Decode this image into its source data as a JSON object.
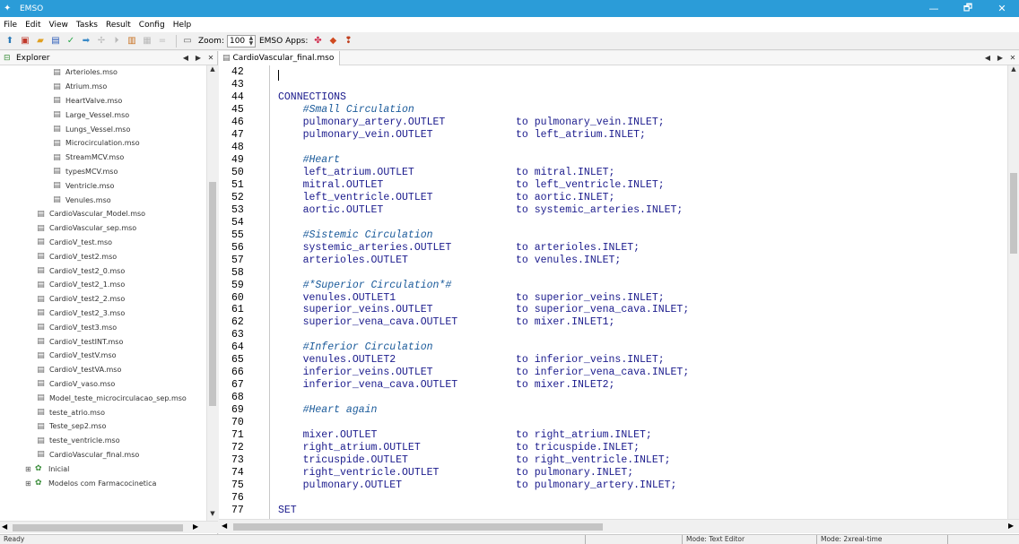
{
  "window": {
    "title": "EMSO",
    "app_icon": "emso-logo-icon",
    "minimize": "—",
    "maximize": "🗗",
    "close": "✕"
  },
  "menu": [
    {
      "label": "File"
    },
    {
      "label": "Edit"
    },
    {
      "label": "View"
    },
    {
      "label": "Tasks"
    },
    {
      "label": "Result"
    },
    {
      "label": "Config"
    },
    {
      "label": "Help"
    }
  ],
  "toolbar": {
    "zoom_label": "Zoom:",
    "zoom_value": "100",
    "apps_label": "EMSO Apps:"
  },
  "explorer": {
    "title": "Explorer",
    "items": [
      {
        "label": "Arterioles.mso",
        "indent": 3
      },
      {
        "label": "Atrium.mso",
        "indent": 3
      },
      {
        "label": "HeartValve.mso",
        "indent": 3
      },
      {
        "label": "Large_Vessel.mso",
        "indent": 3
      },
      {
        "label": "Lungs_Vessel.mso",
        "indent": 3
      },
      {
        "label": "Microcirculation.mso",
        "indent": 3
      },
      {
        "label": "StreamMCV.mso",
        "indent": 3
      },
      {
        "label": "typesMCV.mso",
        "indent": 3
      },
      {
        "label": "Ventricle.mso",
        "indent": 3
      },
      {
        "label": "Venules.mso",
        "indent": 3
      },
      {
        "label": "CardioVascular_Model.mso",
        "indent": 2
      },
      {
        "label": "CardioVascular_sep.mso",
        "indent": 2
      },
      {
        "label": "CardioV_test.mso",
        "indent": 2
      },
      {
        "label": "CardioV_test2.mso",
        "indent": 2
      },
      {
        "label": "CardioV_test2_0.mso",
        "indent": 2
      },
      {
        "label": "CardioV_test2_1.mso",
        "indent": 2
      },
      {
        "label": "CardioV_test2_2.mso",
        "indent": 2
      },
      {
        "label": "CardioV_test2_3.mso",
        "indent": 2
      },
      {
        "label": "CardioV_test3.mso",
        "indent": 2
      },
      {
        "label": "CardioV_testINT.mso",
        "indent": 2
      },
      {
        "label": "CardioV_testV.mso",
        "indent": 2
      },
      {
        "label": "CardioV_testVA.mso",
        "indent": 2
      },
      {
        "label": "CardioV_vaso.mso",
        "indent": 2
      },
      {
        "label": "Model_teste_microcirculacao_sep.mso",
        "indent": 2
      },
      {
        "label": "teste_atrio.mso",
        "indent": 2
      },
      {
        "label": "Teste_sep2.mso",
        "indent": 2
      },
      {
        "label": "teste_ventricle.mso",
        "indent": 2
      },
      {
        "label": "CardioVascular_final.mso",
        "indent": 2
      }
    ],
    "folders": [
      {
        "label": "Inicial",
        "expander": "⊞"
      },
      {
        "label": "Modelos com Farmacocinetica",
        "expander": "⊞"
      }
    ]
  },
  "editor": {
    "tab_label": "CardioVascular_final.mso",
    "lines": [
      {
        "n": "42",
        "a": "",
        "b": ""
      },
      {
        "n": "43",
        "a": "",
        "b": ""
      },
      {
        "n": "44",
        "a": "CONNECTIONS",
        "b": "",
        "type": "kw"
      },
      {
        "n": "45",
        "a": "    #Small Circulation",
        "b": "",
        "type": "cm"
      },
      {
        "n": "46",
        "a": "    pulmonary_artery.OUTLET",
        "b": "to pulmonary_vein.INLET;"
      },
      {
        "n": "47",
        "a": "    pulmonary_vein.OUTLET",
        "b": "to left_atrium.INLET;"
      },
      {
        "n": "48",
        "a": "",
        "b": ""
      },
      {
        "n": "49",
        "a": "    #Heart",
        "b": "",
        "type": "cm"
      },
      {
        "n": "50",
        "a": "    left_atrium.OUTLET",
        "b": "to mitral.INLET;"
      },
      {
        "n": "51",
        "a": "    mitral.OUTLET",
        "b": "to left_ventricle.INLET;"
      },
      {
        "n": "52",
        "a": "    left_ventricle.OUTLET",
        "b": "to aortic.INLET;"
      },
      {
        "n": "53",
        "a": "    aortic.OUTLET",
        "b": "to systemic_arteries.INLET;"
      },
      {
        "n": "54",
        "a": "",
        "b": ""
      },
      {
        "n": "55",
        "a": "    #Sistemic Circulation",
        "b": "",
        "type": "cm"
      },
      {
        "n": "56",
        "a": "    systemic_arteries.OUTLET",
        "b": "to arterioles.INLET;"
      },
      {
        "n": "57",
        "a": "    arterioles.OUTLET",
        "b": "to venules.INLET;"
      },
      {
        "n": "58",
        "a": "",
        "b": ""
      },
      {
        "n": "59",
        "a": "    #*Superior Circulation*#",
        "b": "",
        "type": "cm"
      },
      {
        "n": "60",
        "a": "    venules.OUTLET1",
        "b": "to superior_veins.INLET;"
      },
      {
        "n": "61",
        "a": "    superior_veins.OUTLET",
        "b": "to superior_vena_cava.INLET;"
      },
      {
        "n": "62",
        "a": "    superior_vena_cava.OUTLET",
        "b": "to mixer.INLET1;"
      },
      {
        "n": "63",
        "a": "",
        "b": ""
      },
      {
        "n": "64",
        "a": "    #Inferior Circulation",
        "b": "",
        "type": "cm"
      },
      {
        "n": "65",
        "a": "    venules.OUTLET2",
        "b": "to inferior_veins.INLET;"
      },
      {
        "n": "66",
        "a": "    inferior_veins.OUTLET",
        "b": "to inferior_vena_cava.INLET;"
      },
      {
        "n": "67",
        "a": "    inferior_vena_cava.OUTLET",
        "b": "to mixer.INLET2;"
      },
      {
        "n": "68",
        "a": "",
        "b": ""
      },
      {
        "n": "69",
        "a": "    #Heart again",
        "b": "",
        "type": "cm"
      },
      {
        "n": "70",
        "a": "",
        "b": ""
      },
      {
        "n": "71",
        "a": "    mixer.OUTLET",
        "b": "to right_atrium.INLET;"
      },
      {
        "n": "72",
        "a": "    right_atrium.OUTLET",
        "b": "to tricuspide.INLET;"
      },
      {
        "n": "73",
        "a": "    tricuspide.OUTLET",
        "b": "to right_ventricle.INLET;"
      },
      {
        "n": "74",
        "a": "    right_ventricle.OUTLET",
        "b": "to pulmonary.INLET;"
      },
      {
        "n": "75",
        "a": "    pulmonary.OUTLET",
        "b": "to pulmonary_artery.INLET;"
      },
      {
        "n": "76",
        "a": "",
        "b": ""
      },
      {
        "n": "77",
        "a": "SET",
        "b": "",
        "type": "kw"
      }
    ]
  },
  "status": {
    "left": "Ready",
    "mode1": "Mode: Text Editor",
    "mode2": "Mode: 2xreal-time"
  }
}
